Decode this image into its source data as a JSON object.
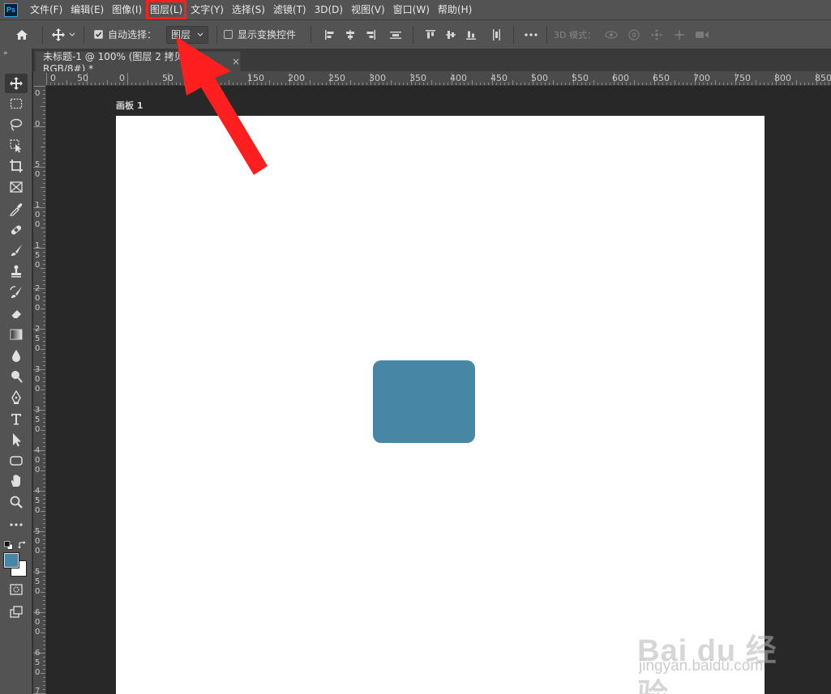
{
  "app": {
    "logo": "Ps"
  },
  "menu": {
    "items": [
      {
        "label": "文件(F)"
      },
      {
        "label": "编辑(E)"
      },
      {
        "label": "图像(I)"
      },
      {
        "label": "图层(L)",
        "highlighted": true
      },
      {
        "label": "文字(Y)"
      },
      {
        "label": "选择(S)"
      },
      {
        "label": "滤镜(T)"
      },
      {
        "label": "3D(D)"
      },
      {
        "label": "视图(V)"
      },
      {
        "label": "窗口(W)"
      },
      {
        "label": "帮助(H)"
      }
    ]
  },
  "options": {
    "auto_select_label": "自动选择：",
    "auto_select_checked": true,
    "layer_select_value": "图层",
    "show_transform_label": "显示变换控件",
    "show_transform_checked": false,
    "mode_3d_label": "3D 模式："
  },
  "document": {
    "tab_title": "未标题-1 @ 100% (图层 2 拷贝, RGB/8#) *",
    "tab_close": "×",
    "artboard_label": "画板 1"
  },
  "rulers": {
    "top_labels": [
      "0",
      "50",
      "0",
      "50",
      "150",
      "200",
      "250",
      "300",
      "350",
      "400",
      "450",
      "500",
      "550",
      "600",
      "650",
      "700",
      "750",
      "800",
      "850"
    ],
    "left_labels": [
      "0",
      "0",
      "5 0",
      "1 0 0",
      "1 5 0",
      "2 0 0",
      "2 5 0",
      "3 0 0",
      "3 5 0",
      "4 0 0",
      "4 5 0",
      "5 0 0",
      "5 5 0",
      "6 0 0",
      "6 5 0",
      "7"
    ]
  },
  "colors": {
    "foreground": "#4787a5",
    "background": "#ffffff",
    "shape_fill": "#4787a5",
    "annotation": "#ff1f1f"
  },
  "watermark": {
    "text": "Bai du 经验",
    "sub": "jingyan.baidu.com"
  }
}
